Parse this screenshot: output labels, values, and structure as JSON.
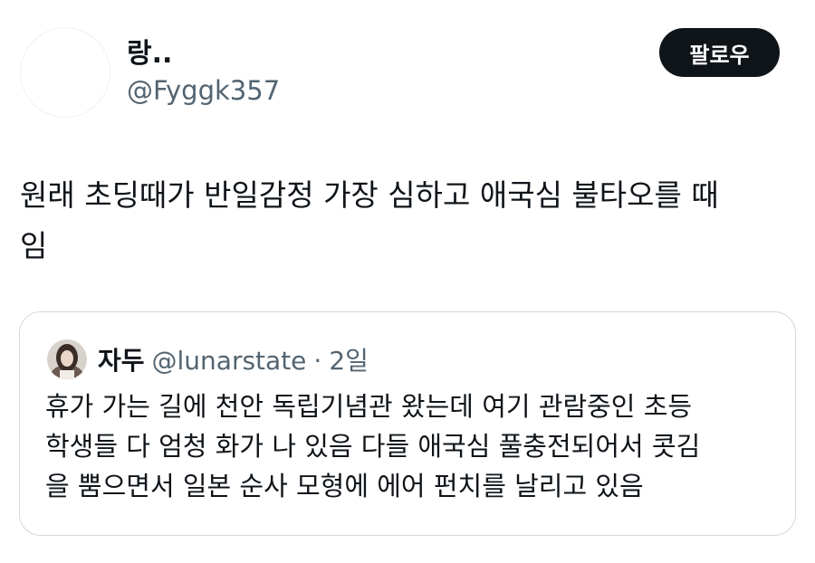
{
  "author": {
    "display_name": "랑..",
    "handle": "@Fyggk357"
  },
  "follow_button": {
    "label": "팔로우"
  },
  "tweet": {
    "text": "원래 초딩때가 반일감정 가장 심하고 애국심 불타오를 때\n임"
  },
  "quote": {
    "display_name": "자두",
    "handle": "@lunarstate",
    "separator": "·",
    "time": "2일",
    "text": "휴가 가는 길에 천안 독립기념관 왔는데 여기 관람중인 초등\n학생들 다 엄청 화가 나 있음 다들 애국심 풀충전되어서 콧김\n을 뿜으면서 일본 순사 모형에 에어 펀치를 날리고 있음"
  },
  "colors": {
    "text_primary": "#0f1419",
    "text_secondary": "#536471",
    "button_bg": "#0f1419",
    "border": "#cfd9de"
  }
}
